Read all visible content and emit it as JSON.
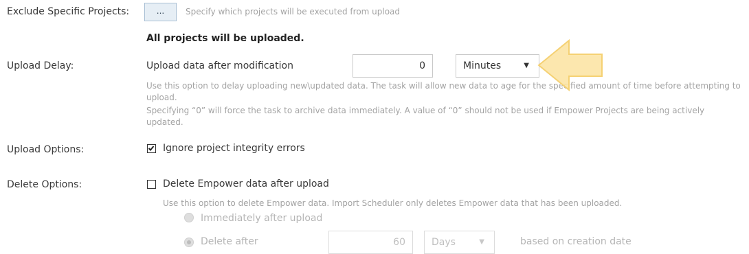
{
  "exclude": {
    "label": "Exclude Specific Projects:",
    "button_label": "...",
    "help": "Specify which projects will be executed from upload",
    "status": "All projects will be uploaded."
  },
  "upload_delay": {
    "label": "Upload Delay:",
    "field_label": "Upload data after modification",
    "value": "0",
    "unit": "Minutes",
    "help1": "Use this option to delay uploading new\\updated data. The task will allow new data to age for the specified amount of time before attempting to upload.",
    "help2": "Specifying “0” will force the task to archive data immediately. A value of “0” should not be used if Empower Projects are being actively updated."
  },
  "upload_options": {
    "label": "Upload Options:",
    "checkbox_label": "Ignore project integrity errors",
    "checked": true
  },
  "delete_options": {
    "label": "Delete Options:",
    "checkbox_label": "Delete Empower data after upload",
    "checked": false,
    "help": "Use this option to delete Empower data. Import Scheduler only deletes Empower data that has been uploaded.",
    "radio_immediately": "Immediately after upload",
    "radio_after": "Delete after",
    "after_value": "60",
    "after_unit": "Days",
    "after_suffix": "based on creation date"
  },
  "colors": {
    "arrow_fill": "#fbe3a0",
    "arrow_stroke": "#f5d173"
  }
}
